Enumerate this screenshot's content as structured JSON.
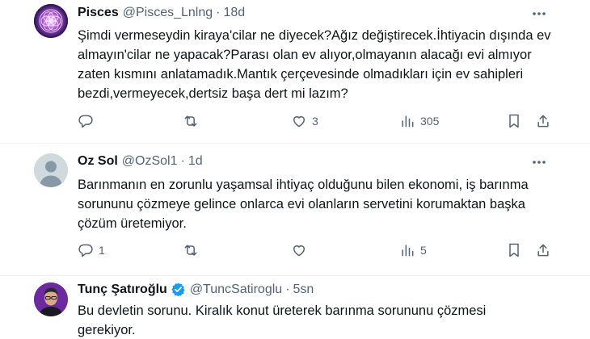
{
  "tweets": [
    {
      "name": "Pisces",
      "handle": "@Pisces_Lnlng",
      "separator": "·",
      "time": "18d",
      "text": "Şimdi vermeseydin kiraya'cilar ne diyecek?Ağız değiştirecek.İhtiyacin dışında ev almayın'cilar ne yapacak?Parası olan ev alıyor,olmayanın alacağı evi almıyor zaten kısmını anlatamadık.Mantık çerçevesinde olmadıkları için ev sahipleri bezdi,vermeyecek,dertsiz başa dert mi lazım?",
      "reply_count": "",
      "retweet_count": "",
      "like_count": "3",
      "view_count": "305",
      "verified": false,
      "avatar_icon": "mandala-avatar-icon"
    },
    {
      "name": "Oz Sol",
      "handle": "@OzSol1",
      "separator": "·",
      "time": "1d",
      "text": "Barınmanın en zorunlu yaşamsal ihtiyaç olduğunu bilen ekonomi, iş barınma sorununu çözmeye gelince onlarca evi olanların servetini korumaktan başka çözüm üretemiyor.",
      "reply_count": "1",
      "retweet_count": "",
      "like_count": "",
      "view_count": "5",
      "verified": false,
      "avatar_icon": "default-profile-icon"
    },
    {
      "name": "Tunç Şatıroğlu",
      "handle": "@TuncSatiroglu",
      "separator": "·",
      "time": "5sn",
      "text": "Bu devletin sorunu. Kiralık konut üreterek barınma sorununu çözmesi gerekiyor.",
      "verified": true,
      "avatar_icon": "portrait-avatar-icon"
    }
  ],
  "icons": {
    "reply": "reply-icon",
    "retweet": "retweet-icon",
    "like": "like-icon",
    "views": "views-icon",
    "bookmark": "bookmark-icon",
    "share": "share-icon",
    "more": "more-icon",
    "verified": "verified-badge-icon"
  },
  "colors": {
    "text": "#0f1419",
    "secondary": "#536471",
    "divider": "#eff3f4",
    "verified": "#1d9bf0"
  }
}
